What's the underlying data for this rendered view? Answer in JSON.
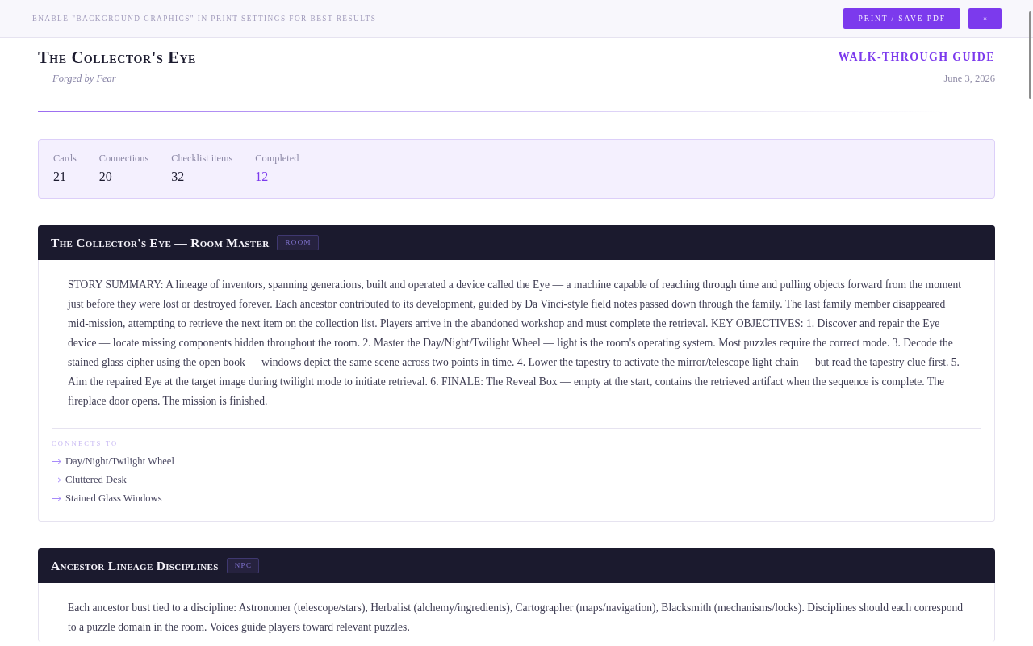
{
  "top_bar": {
    "hint": "ENABLE \"BACKGROUND GRAPHICS\" IN PRINT SETTINGS FOR BEST RESULTS",
    "print_button": "PRINT / SAVE PDF",
    "close_button": "×"
  },
  "header": {
    "title": "The Collector's Eye",
    "subtitle": "Forged by Fear",
    "guide_label": "WALK-THROUGH GUIDE",
    "date": "June 3, 2026"
  },
  "stats": [
    {
      "label": "Cards",
      "value": "21",
      "accent": false
    },
    {
      "label": "Connections",
      "value": "20",
      "accent": false
    },
    {
      "label": "Checklist items",
      "value": "32",
      "accent": false
    },
    {
      "label": "Completed",
      "value": "12",
      "accent": true
    }
  ],
  "cards": [
    {
      "title": "The Collector's Eye — Room Master",
      "badge": "ROOM",
      "description": "STORY SUMMARY: A lineage of inventors, spanning generations, built and operated a device called the Eye — a machine capable of reaching through time and pulling objects forward from the moment just before they were lost or destroyed forever. Each ancestor contributed to its development, guided by Da Vinci-style field notes passed down through the family. The last family member disappeared mid-mission, attempting to retrieve the next item on the collection list. Players arrive in the abandoned workshop and must complete the retrieval. KEY OBJECTIVES: 1. Discover and repair the Eye device — locate missing components hidden throughout the room. 2. Master the Day/Night/Twilight Wheel — light is the room's operating system. Most puzzles require the correct mode. 3. Decode the stained glass cipher using the open book — windows depict the same scene across two points in time. 4. Lower the tapestry to activate the mirror/telescope light chain — but read the tapestry clue first. 5. Aim the repaired Eye at the target image during twilight mode to initiate retrieval. 6. FINALE: The Reveal Box — empty at the start, contains the retrieved artifact when the sequence is complete. The fireplace door opens. The mission is finished.",
      "connects_heading": "CONNECTS TO",
      "connects": [
        "Day/Night/Twilight Wheel",
        "Cluttered Desk",
        "Stained Glass Windows"
      ]
    },
    {
      "title": "Ancestor Lineage Disciplines",
      "badge": "NPC",
      "description": "Each ancestor bust tied to a discipline: Astronomer (telescope/stars), Herbalist (alchemy/ingredients), Cartographer (maps/navigation), Blacksmith (mechanisms/locks). Disciplines should each correspond to a puzzle domain in the room. Voices guide players toward relevant puzzles."
    }
  ]
}
